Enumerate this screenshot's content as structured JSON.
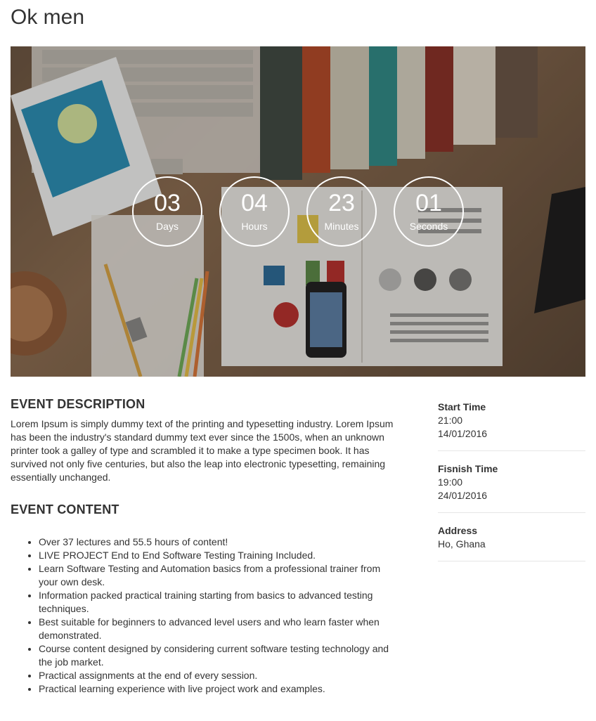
{
  "page": {
    "title": "Ok men"
  },
  "countdown": [
    {
      "value": "03",
      "label": "Days"
    },
    {
      "value": "04",
      "label": "Hours"
    },
    {
      "value": "23",
      "label": "Minutes"
    },
    {
      "value": "01",
      "label": "Seconds"
    }
  ],
  "description": {
    "heading": "EVENT DESCRIPTION",
    "text": "Lorem Ipsum is simply dummy text of the printing and typesetting industry. Lorem Ipsum has been the industry's standard dummy text ever since the 1500s, when an unknown printer took a galley of type and scrambled it to make a type specimen book. It has survived not only five centuries, but also the leap into electronic typesetting, remaining essentially unchanged."
  },
  "content": {
    "heading": "EVENT CONTENT",
    "items": [
      "Over 37 lectures and 55.5 hours of content!",
      "LIVE PROJECT End to End Software Testing Training Included.",
      "Learn Software Testing and Automation basics from a professional trainer from your own desk.",
      "Information packed practical training starting from basics to advanced testing techniques.",
      "Best suitable for beginners to advanced level users and who learn faster when demonstrated.",
      "Course content designed by considering current software testing technology and the job market.",
      "Practical assignments at the end of every session.",
      "Practical learning experience with live project work and examples."
    ]
  },
  "details": {
    "start": {
      "label": "Start Time",
      "time": "21:00",
      "date": "14/01/2016"
    },
    "finish": {
      "label": "Fisnish Time",
      "time": "19:00",
      "date": "24/01/2016"
    },
    "address": {
      "label": "Address",
      "value": "Ho, Ghana"
    }
  }
}
